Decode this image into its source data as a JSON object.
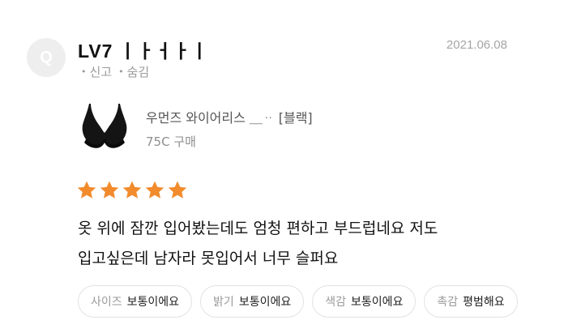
{
  "review": {
    "avatar_letter": "Q",
    "username": "LV7 ㅣㅏㅓㅏㅣ",
    "date": "2021.06.08",
    "actions": [
      "신고",
      "숨김"
    ],
    "product": {
      "name": "우먼즈 와이어리스 ＿ᆢ [블랙]",
      "option": "75C 구매",
      "image_icon": "bra-icon"
    },
    "rating": 5,
    "star_color": "#f28b2c",
    "text_line1": "옷 위에 잠깐 입어봤는데도 엄청 편하고 부드럽네요 저도",
    "text_line2": "입고싶은데 남자라 못입어서 너무 슬퍼요",
    "tags": [
      {
        "key": "사이즈",
        "value": "보통이에요"
      },
      {
        "key": "밝기",
        "value": "보통이에요"
      },
      {
        "key": "색감",
        "value": "보통이에요"
      },
      {
        "key": "촉감",
        "value": "평범해요"
      }
    ]
  }
}
